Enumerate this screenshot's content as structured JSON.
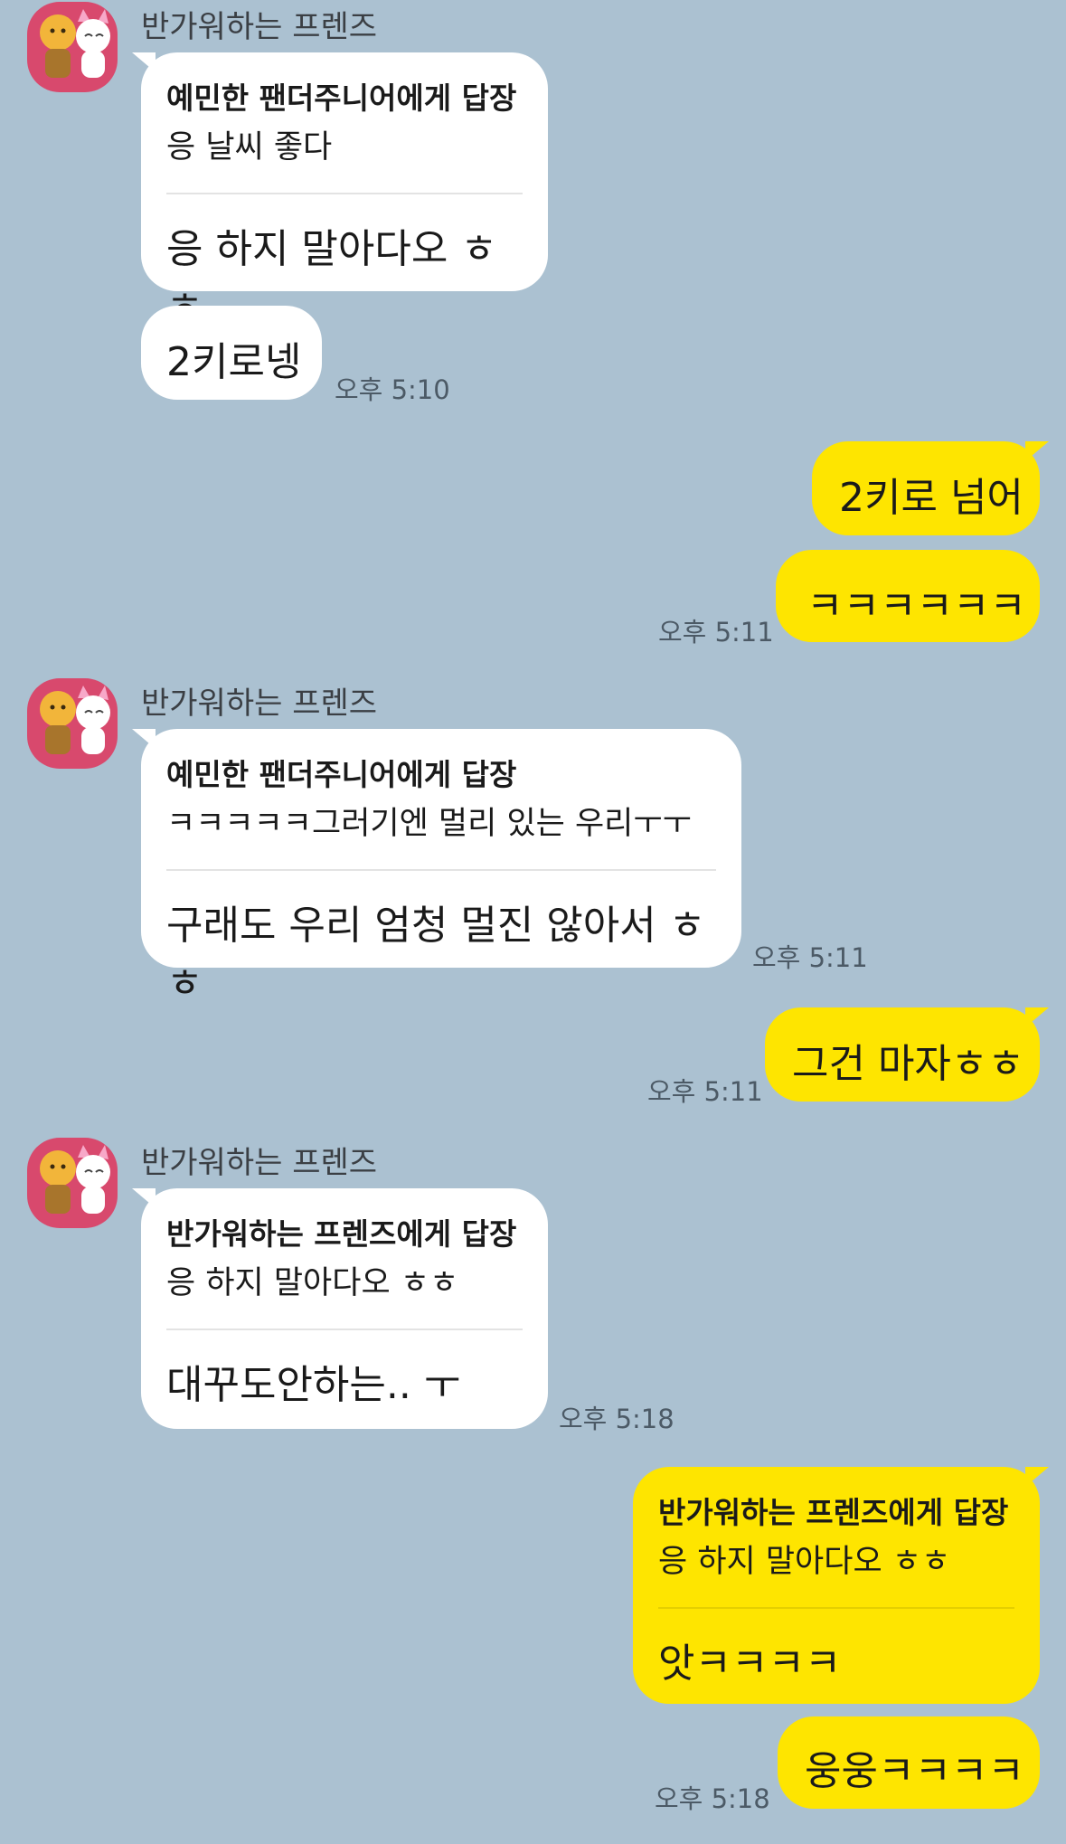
{
  "messages": {
    "g1": {
      "sender": "반가워하는 프렌즈",
      "reply_to": "예민한 팬더주니어에게 답장",
      "quote": "응 날씨 좋다",
      "body": "응 하지 말아다오 ㅎㅎ",
      "second": "2키로넹",
      "time": "오후 5:10"
    },
    "o1": {
      "a": "2키로 넘어",
      "b": "ㅋㅋㅋㅋㅋㅋ",
      "time": "오후 5:11"
    },
    "g2": {
      "sender": "반가워하는 프렌즈",
      "reply_to": "예민한 팬더주니어에게 답장",
      "quote": "ㅋㅋㅋㅋㅋ그러기엔 멀리 있는 우리ㅜㅜ",
      "body": "구래도 우리 엄청 멀진 않아서 ㅎㅎ",
      "time": "오후 5:11"
    },
    "o2": {
      "a": "그건 마자ㅎㅎ",
      "time": "오후 5:11"
    },
    "g3": {
      "sender": "반가워하는 프렌즈",
      "reply_to": "반가워하는 프렌즈에게 답장",
      "quote": "응 하지 말아다오 ㅎㅎ",
      "body": "대꾸도안하는.. ㅜ",
      "time": "오후 5:18"
    },
    "o3": {
      "reply_to": "반가워하는 프렌즈에게 답장",
      "quote": "응 하지 말아다오 ㅎㅎ",
      "body": "앗ㅋㅋㅋㅋ",
      "second": "웅웅ㅋㅋㅋㅋ",
      "time": "오후 5:18"
    }
  },
  "colors": {
    "background": "#abc1d1",
    "incoming_bubble": "#ffffff",
    "outgoing_bubble": "#fee500",
    "avatar_bg": "#d8496d"
  }
}
